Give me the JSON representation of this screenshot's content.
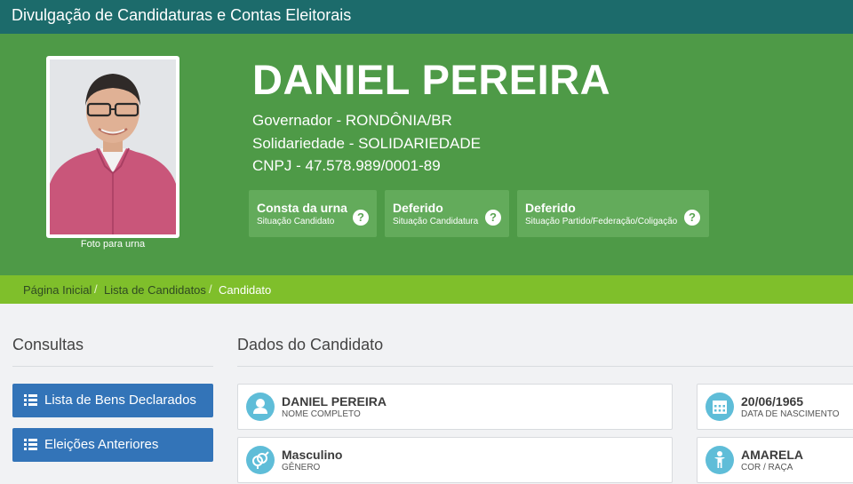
{
  "header": {
    "title": "Divulgação de Candidaturas e Contas Eleitorais"
  },
  "candidate": {
    "photo_caption": "Foto para urna",
    "name": "DANIEL PEREIRA",
    "office": "Governador - RONDÔNIA/BR",
    "party": "Solidariedade - SOLIDARIEDADE",
    "cnpj": "CNPJ - 47.578.989/0001-89"
  },
  "status_cards": [
    {
      "value": "Consta da urna",
      "label": "Situação Candidato"
    },
    {
      "value": "Deferido",
      "label": "Situação Candidatura"
    },
    {
      "value": "Deferido",
      "label": "Situação Partido/Federação/Coligação"
    }
  ],
  "breadcrumb": {
    "items": [
      "Página Inicial",
      "Lista de Candidatos",
      "Candidato"
    ],
    "separator": "/"
  },
  "sidebar": {
    "title": "Consultas",
    "buttons": [
      "Lista de Bens Declarados",
      "Eleições Anteriores"
    ]
  },
  "main": {
    "title": "Dados do Candidato",
    "fields": [
      {
        "value": "DANIEL PEREIRA",
        "label": "NOME COMPLETO",
        "icon": "user-icon"
      },
      {
        "value": "20/06/1965",
        "label": "DATA DE NASCIMENTO",
        "icon": "calendar-icon"
      },
      {
        "value": "Masculino",
        "label": "GÊNERO",
        "icon": "gender-icon"
      },
      {
        "value": "AMARELA",
        "label": "COR / RAÇA",
        "icon": "person-icon"
      }
    ]
  },
  "colors": {
    "topbar": "#1c6b6b",
    "hero": "#4e9a47",
    "status_card": "#63ab5b",
    "breadcrumb_bar": "#7fbf2b",
    "button": "#3374b8",
    "field_icon": "#5fbdd8"
  }
}
